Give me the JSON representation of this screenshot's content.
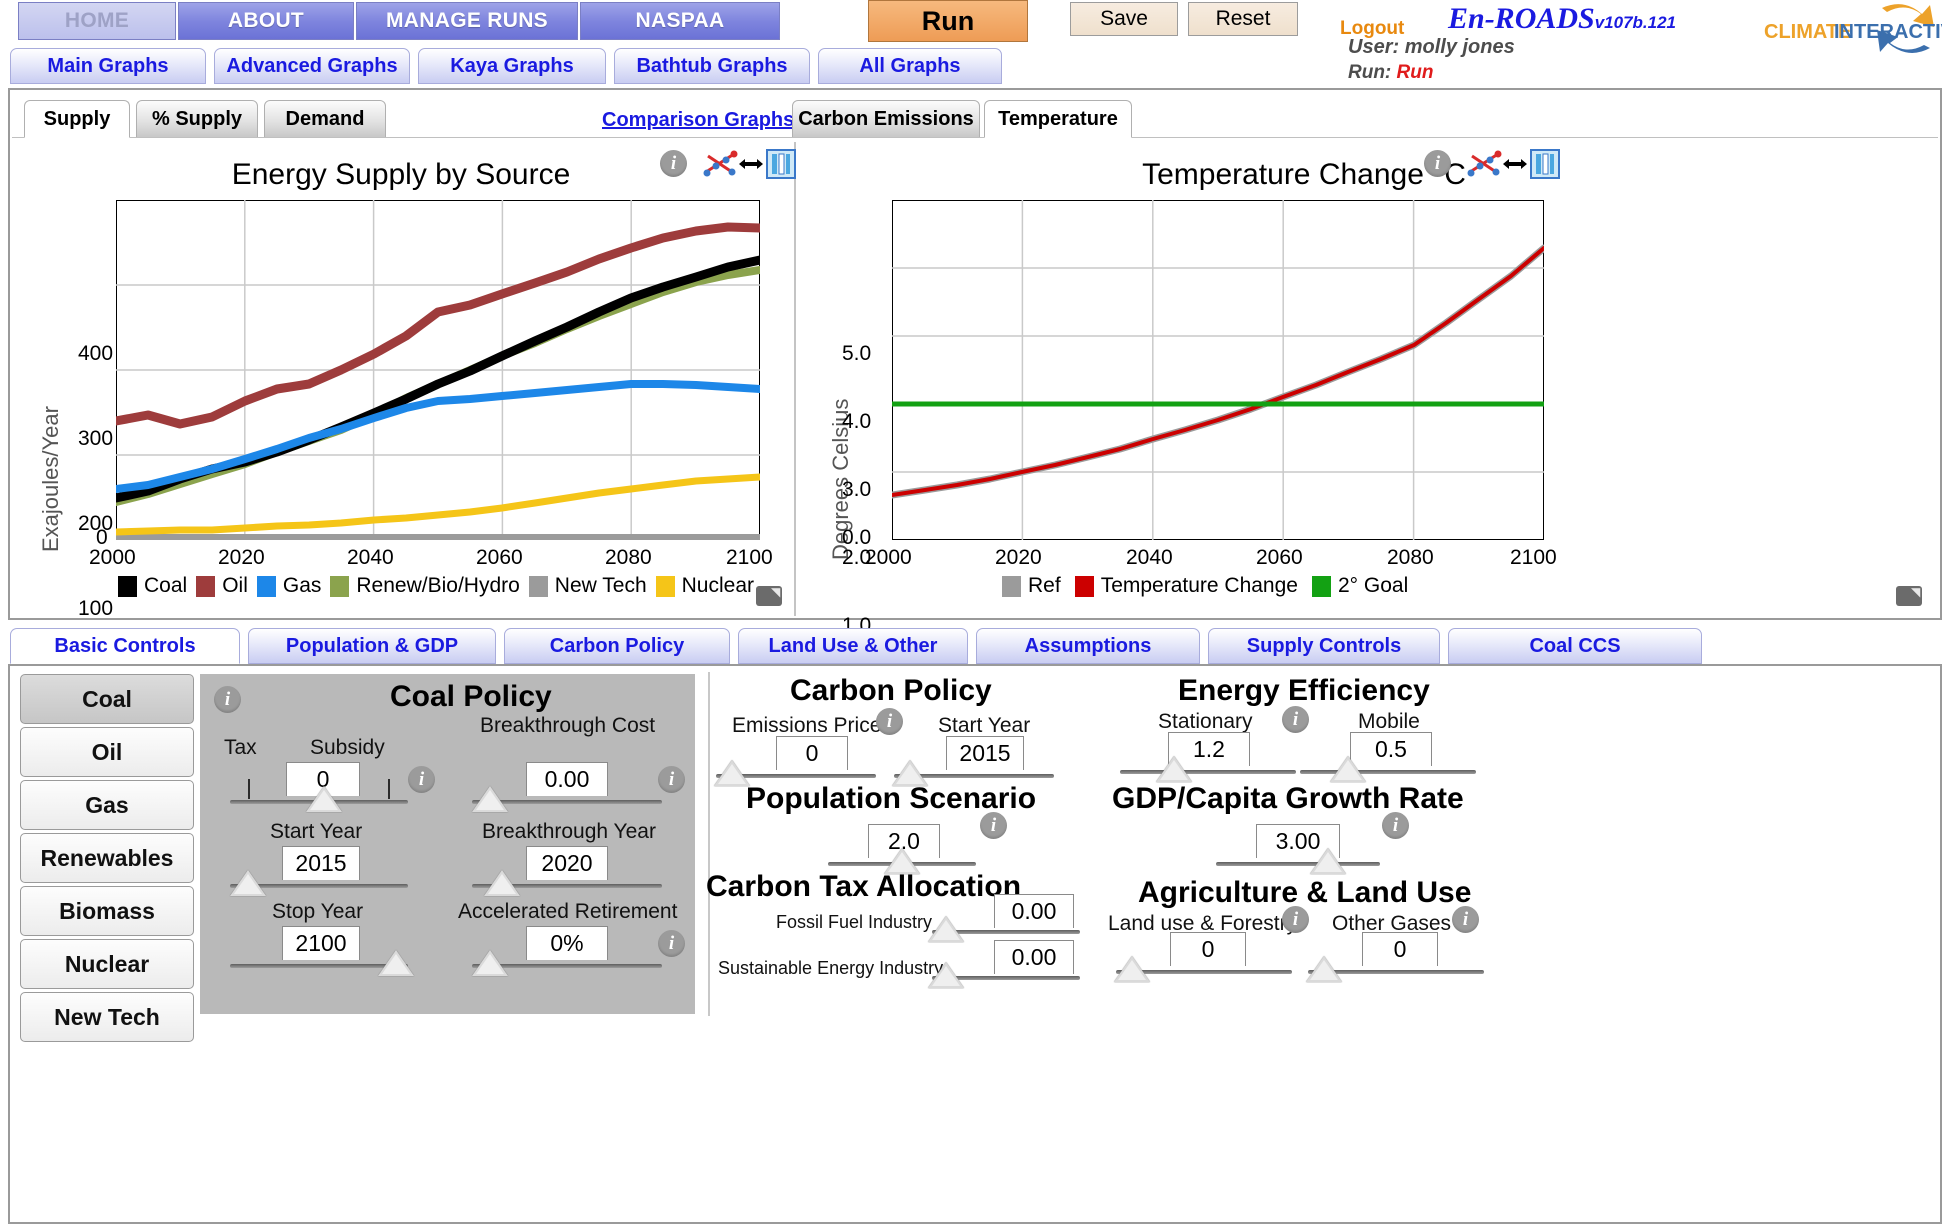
{
  "topnav": {
    "tabs": [
      {
        "label": "HOME",
        "state": "disabled"
      },
      {
        "label": "ABOUT",
        "state": "normal"
      },
      {
        "label": "MANAGE RUNS",
        "state": "normal"
      },
      {
        "label": "NASPAA",
        "state": "normal"
      }
    ],
    "run_button": "Run",
    "save_button": "Save",
    "reset_button": "Reset",
    "logout": "Logout",
    "brand": "En-ROADS",
    "version": "v107b.121",
    "user_label": "User:",
    "user_name": "molly jones",
    "run_label": "Run:",
    "run_name": "Run",
    "logo_primary": "CLIMATE",
    "logo_secondary": "INTERACTIVE"
  },
  "graph_tabs": [
    {
      "label": "Main Graphs",
      "active": true
    },
    {
      "label": "Advanced Graphs",
      "active": false
    },
    {
      "label": "Kaya Graphs",
      "active": false
    },
    {
      "label": "Bathtub Graphs",
      "active": false
    },
    {
      "label": "All Graphs",
      "active": false
    }
  ],
  "sub_tabs_left": [
    {
      "label": "Supply",
      "active": true
    },
    {
      "label": "% Supply",
      "active": false
    },
    {
      "label": "Demand",
      "active": false
    }
  ],
  "comparison_link": "Comparison Graphs",
  "sub_tabs_right": [
    {
      "label": "Carbon Emissions",
      "active": false
    },
    {
      "label": "Temperature",
      "active": true
    }
  ],
  "chart_data": [
    {
      "type": "line",
      "title": "Energy Supply by Source",
      "xlabel": "",
      "ylabel": "Exajoules/Year",
      "xlim": [
        2000,
        2100
      ],
      "ylim": [
        0,
        400
      ],
      "xticks": [
        2000,
        2020,
        2040,
        2060,
        2080,
        2100
      ],
      "yticks": [
        0,
        100,
        200,
        300,
        400
      ],
      "grid": true,
      "legend_position": "bottom",
      "x": [
        2000,
        2005,
        2010,
        2015,
        2020,
        2025,
        2030,
        2035,
        2040,
        2045,
        2050,
        2055,
        2060,
        2065,
        2070,
        2075,
        2080,
        2085,
        2090,
        2095,
        2100
      ],
      "series": [
        {
          "name": "Coal",
          "color": "#000000",
          "values": [
            50,
            58,
            72,
            83,
            92,
            104,
            118,
            133,
            150,
            166,
            183,
            199,
            216,
            234,
            251,
            268,
            285,
            298,
            310,
            321,
            330
          ]
        },
        {
          "name": "Oil",
          "color": "#9e3c3c",
          "values": [
            140,
            148,
            136,
            145,
            163,
            178,
            184,
            200,
            219,
            240,
            268,
            277,
            290,
            303,
            315,
            330,
            343,
            355,
            364,
            368,
            367
          ]
        },
        {
          "name": "Gas",
          "color": "#1d87e8",
          "values": [
            60,
            65,
            74,
            84,
            95,
            107,
            119,
            131,
            144,
            155,
            163,
            165,
            169,
            173,
            177,
            180,
            184,
            184,
            182,
            180,
            178
          ]
        },
        {
          "name": "Renew/Bio/Hydro",
          "color": "#8ba34d",
          "values": [
            45,
            54,
            66,
            78,
            90,
            104,
            117,
            130,
            147,
            167,
            184,
            200,
            216,
            232,
            248,
            264,
            278,
            292,
            303,
            312,
            318
          ]
        },
        {
          "name": "New Tech",
          "color": "#9b9b9b",
          "values": [
            2,
            2,
            2,
            2,
            2,
            2,
            2,
            2,
            2,
            2,
            2,
            2,
            2,
            2,
            2,
            2,
            2,
            2,
            2,
            2,
            2
          ]
        },
        {
          "name": "Nuclear",
          "color": "#f5c518",
          "values": [
            9,
            10,
            11,
            12,
            14,
            16,
            18,
            20,
            23,
            26,
            29,
            33,
            38,
            43,
            49,
            55,
            60,
            65,
            69,
            72,
            74
          ]
        }
      ]
    },
    {
      "type": "line",
      "title": "Temperature Change °C",
      "xlabel": "",
      "ylabel": "Degrees Celsius",
      "xlim": [
        2000,
        2100
      ],
      "ylim": [
        0.0,
        5.0
      ],
      "xticks": [
        2000,
        2020,
        2040,
        2060,
        2080,
        2100
      ],
      "yticks": [
        "0.0",
        "1.0",
        "2.0",
        "3.0",
        "4.0",
        "5.0"
      ],
      "grid": true,
      "legend_position": "bottom",
      "x": [
        2000,
        2005,
        2010,
        2015,
        2020,
        2025,
        2030,
        2035,
        2040,
        2045,
        2050,
        2055,
        2060,
        2065,
        2070,
        2075,
        2080,
        2085,
        2090,
        2095,
        2100
      ],
      "series": [
        {
          "name": "Ref",
          "color": "#9b9b9b",
          "values": [
            0.66,
            0.74,
            0.81,
            0.9,
            1.0,
            1.1,
            1.22,
            1.34,
            1.48,
            1.62,
            1.77,
            1.93,
            2.1,
            2.28,
            2.47,
            2.66,
            2.87,
            3.24,
            3.6,
            3.96,
            4.3
          ]
        },
        {
          "name": "Temperature Change",
          "color": "#cc0000",
          "values": [
            0.66,
            0.74,
            0.81,
            0.9,
            1.0,
            1.1,
            1.22,
            1.34,
            1.48,
            1.62,
            1.77,
            1.93,
            2.1,
            2.28,
            2.47,
            2.66,
            2.87,
            3.24,
            3.6,
            3.96,
            4.3
          ]
        },
        {
          "name": "2° Goal",
          "color": "#13a113",
          "values": [
            2.0,
            2.0,
            2.0,
            2.0,
            2.0,
            2.0,
            2.0,
            2.0,
            2.0,
            2.0,
            2.0,
            2.0,
            2.0,
            2.0,
            2.0,
            2.0,
            2.0,
            2.0,
            2.0,
            2.0,
            2.0
          ]
        }
      ]
    }
  ],
  "control_tabs": [
    {
      "label": "Basic Controls",
      "active": true
    },
    {
      "label": "Population & GDP",
      "active": false
    },
    {
      "label": "Carbon Policy",
      "active": false
    },
    {
      "label": "Land Use & Other",
      "active": false
    },
    {
      "label": "Assumptions",
      "active": false
    },
    {
      "label": "Supply Controls",
      "active": false
    },
    {
      "label": "Coal CCS",
      "active": false
    }
  ],
  "fuel_buttons": [
    {
      "label": "Coal",
      "selected": true
    },
    {
      "label": "Oil",
      "selected": false
    },
    {
      "label": "Gas",
      "selected": false
    },
    {
      "label": "Renewables",
      "selected": false
    },
    {
      "label": "Biomass",
      "selected": false
    },
    {
      "label": "Nuclear",
      "selected": false
    },
    {
      "label": "New Tech",
      "selected": false
    }
  ],
  "coal_policy": {
    "title": "Coal Policy",
    "tax_label": "Tax",
    "subsidy_label": "Subsidy",
    "tax_subsidy_value": "0",
    "start_year_label": "Start Year",
    "start_year_value": "2015",
    "stop_year_label": "Stop Year",
    "stop_year_value": "2100",
    "breakthrough_cost_label": "Breakthrough Cost",
    "breakthrough_cost_value": "0.00",
    "breakthrough_year_label": "Breakthrough Year",
    "breakthrough_year_value": "2020",
    "accelerated_retirement_label": "Accelerated Retirement",
    "accelerated_retirement_value": "0%"
  },
  "carbon_policy": {
    "title": "Carbon Policy",
    "emissions_price_label": "Emissions Price",
    "emissions_price_value": "0",
    "start_year_label": "Start Year",
    "start_year_value": "2015"
  },
  "population_scenario": {
    "title": "Population Scenario",
    "value": "2.0"
  },
  "carbon_tax_allocation": {
    "title": "Carbon Tax Allocation",
    "fossil_label": "Fossil Fuel Industry",
    "fossil_value": "0.00",
    "sustainable_label": "Sustainable Energy Industry",
    "sustainable_value": "0.00"
  },
  "energy_efficiency": {
    "title": "Energy Efficiency",
    "stationary_label": "Stationary",
    "stationary_value": "1.2",
    "mobile_label": "Mobile",
    "mobile_value": "0.5"
  },
  "gdp_growth": {
    "title": "GDP/Capita Growth Rate",
    "value": "3.00"
  },
  "agriculture": {
    "title": "Agriculture & Land Use",
    "landuse_label": "Land use & Forestry",
    "landuse_value": "0",
    "othergases_label": "Other Gases",
    "othergases_value": "0"
  }
}
